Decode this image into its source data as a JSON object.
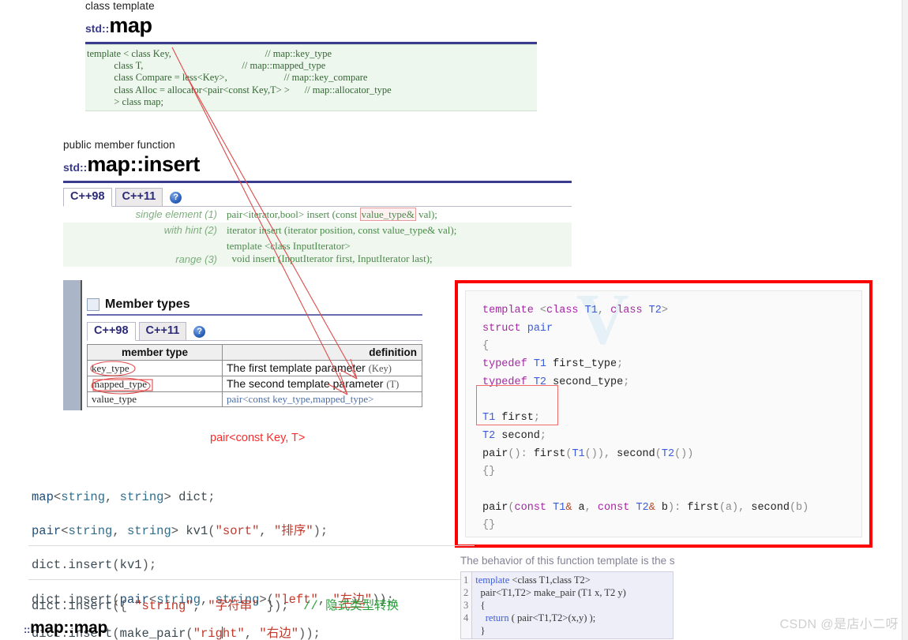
{
  "map_ref": {
    "kicker": "class template",
    "ns": "std::",
    "name": "map",
    "code_lines": [
      "template < class Key,                                      // map::key_type",
      "           class T,                                        // map::mapped_type",
      "           class Compare = less<Key>,                       // map::key_compare",
      "           class Alloc = allocator<pair<const Key,T> >      // map::allocator_type",
      "           > class map;"
    ]
  },
  "insert_ref": {
    "kicker": "public member function",
    "ns": "std::",
    "name": "map::insert",
    "tabs": [
      {
        "label": "C++98",
        "active": true
      },
      {
        "label": "C++11",
        "active": false
      }
    ],
    "help_icon": "?",
    "rows": [
      {
        "label": "single element (1)",
        "code_pre": "pair<iterator,bool> insert (const ",
        "code_box": "value_type&",
        "code_post": " val);"
      },
      {
        "label": "with hint (2)",
        "code_pre": "iterator insert (iterator position, const value_type& val);",
        "code_box": "",
        "code_post": ""
      },
      {
        "label": "range (3)",
        "code_pre": "template <class InputIterator>\n  void insert (InputIterator first, InputIterator last);",
        "code_box": "",
        "code_post": ""
      }
    ]
  },
  "member_types": {
    "heading": "Member types",
    "tabs": [
      {
        "label": "C++98",
        "active": true
      },
      {
        "label": "C++11",
        "active": false
      }
    ],
    "help_icon": "?",
    "columns": [
      "member type",
      "definition"
    ],
    "rows": [
      {
        "name": "key_type",
        "def_main": "The first template parameter ",
        "def_paren": "(Key)",
        "codey": false,
        "circled": true
      },
      {
        "name": "mapped_type",
        "def_main": "The second template parameter ",
        "def_paren": "(T)",
        "codey": false,
        "circled": true
      },
      {
        "name": "value_type",
        "def_main": "pair<const key_type,mapped_type>",
        "def_paren": "",
        "codey": true,
        "circled": false
      }
    ]
  },
  "pair_note": "pair<const Key, T>",
  "pair_panel": {
    "watermark": "V",
    "lines": [
      [
        {
          "t": "template ",
          "c": "kw"
        },
        {
          "t": "<",
          "c": "pun"
        },
        {
          "t": "class",
          "c": "kw"
        },
        {
          "t": " T1",
          "c": "ty"
        },
        {
          "t": ", ",
          "c": "pun"
        },
        {
          "t": "class",
          "c": "kw"
        },
        {
          "t": " T2",
          "c": "ty"
        },
        {
          "t": ">",
          "c": "pun"
        }
      ],
      [
        {
          "t": "struct ",
          "c": "kw"
        },
        {
          "t": "pair",
          "c": "ty"
        }
      ],
      [
        {
          "t": "{",
          "c": "pun"
        }
      ],
      [
        {
          "t": "typedef ",
          "c": "kw"
        },
        {
          "t": "T1",
          "c": "ty"
        },
        {
          "t": " first_type",
          "c": "idn"
        },
        {
          "t": ";",
          "c": "pun"
        }
      ],
      [
        {
          "t": "typedef ",
          "c": "kw"
        },
        {
          "t": "T2",
          "c": "ty"
        },
        {
          "t": " second_type",
          "c": "idn"
        },
        {
          "t": ";",
          "c": "pun"
        }
      ],
      [
        {
          "t": "",
          "c": "pun"
        }
      ],
      [
        {
          "t": "T1",
          "c": "ty"
        },
        {
          "t": " first",
          "c": "idn"
        },
        {
          "t": ";",
          "c": "pun"
        }
      ],
      [
        {
          "t": "T2",
          "c": "ty"
        },
        {
          "t": " second",
          "c": "idn"
        },
        {
          "t": ";",
          "c": "pun"
        }
      ],
      [
        {
          "t": "pair",
          "c": "idn"
        },
        {
          "t": "()",
          "c": "pun"
        },
        {
          "t": ": ",
          "c": "pun"
        },
        {
          "t": "first",
          "c": "idn"
        },
        {
          "t": "(",
          "c": "pun"
        },
        {
          "t": "T1",
          "c": "ty"
        },
        {
          "t": "())",
          "c": "pun"
        },
        {
          "t": ", ",
          "c": "pun"
        },
        {
          "t": "second",
          "c": "idn"
        },
        {
          "t": "(",
          "c": "pun"
        },
        {
          "t": "T2",
          "c": "ty"
        },
        {
          "t": "())",
          "c": "pun"
        }
      ],
      [
        {
          "t": "{}",
          "c": "pun"
        }
      ],
      [
        {
          "t": "",
          "c": "pun"
        }
      ],
      [
        {
          "t": "pair",
          "c": "idn"
        },
        {
          "t": "(",
          "c": "pun"
        },
        {
          "t": "const",
          "c": "kw"
        },
        {
          "t": " T1",
          "c": "ty"
        },
        {
          "t": "&",
          "c": "amp"
        },
        {
          "t": " a",
          "c": "idn"
        },
        {
          "t": ", ",
          "c": "pun"
        },
        {
          "t": "const",
          "c": "kw"
        },
        {
          "t": " T2",
          "c": "ty"
        },
        {
          "t": "&",
          "c": "amp"
        },
        {
          "t": " b",
          "c": "idn"
        },
        {
          "t": "): ",
          "c": "pun"
        },
        {
          "t": "first",
          "c": "idn"
        },
        {
          "t": "(a)",
          "c": "pun"
        },
        {
          "t": ", ",
          "c": "pun"
        },
        {
          "t": "second",
          "c": "idn"
        },
        {
          "t": "(b)",
          "c": "pun"
        }
      ],
      [
        {
          "t": "{}",
          "c": "pun"
        }
      ],
      [
        {
          "t": "};",
          "c": "pun"
        }
      ]
    ]
  },
  "editor": {
    "lines": [
      [
        {
          "t": "map",
          "c": "e-cls"
        },
        {
          "t": "<",
          "c": "e-pun"
        },
        {
          "t": "string",
          "c": "e-type"
        },
        {
          "t": ", ",
          "c": "e-pun"
        },
        {
          "t": "string",
          "c": "e-type"
        },
        {
          "t": "> ",
          "c": "e-pun"
        },
        {
          "t": "dict",
          "c": "e-id"
        },
        {
          "t": ";",
          "c": "e-pun"
        }
      ],
      [
        {
          "t": "pair",
          "c": "e-cls"
        },
        {
          "t": "<",
          "c": "e-pun"
        },
        {
          "t": "string",
          "c": "e-type"
        },
        {
          "t": ", ",
          "c": "e-pun"
        },
        {
          "t": "string",
          "c": "e-type"
        },
        {
          "t": "> ",
          "c": "e-pun"
        },
        {
          "t": "kv1",
          "c": "e-id"
        },
        {
          "t": "(",
          "c": "e-pun"
        },
        {
          "t": "\"sort\"",
          "c": "e-str"
        },
        {
          "t": ", ",
          "c": "e-pun"
        },
        {
          "t": "\"排序\"",
          "c": "e-str"
        },
        {
          "t": ");",
          "c": "e-pun"
        }
      ],
      [
        {
          "t": "dict",
          "c": "e-id"
        },
        {
          "t": ".",
          "c": "e-pun"
        },
        {
          "t": "insert",
          "c": "e-id"
        },
        {
          "t": "(",
          "c": "e-pun"
        },
        {
          "t": "kv1",
          "c": "e-id"
        },
        {
          "t": ");",
          "c": "e-pun"
        }
      ],
      [
        {
          "t": "dict",
          "c": "e-id"
        },
        {
          "t": ".",
          "c": "e-pun"
        },
        {
          "t": "insert",
          "c": "e-id"
        },
        {
          "t": "(",
          "c": "e-pun"
        },
        {
          "t": "pair",
          "c": "e-cls"
        },
        {
          "t": "<",
          "c": "e-pun"
        },
        {
          "t": "string",
          "c": "e-type"
        },
        {
          "t": ", ",
          "c": "e-pun"
        },
        {
          "t": "string",
          "c": "e-type"
        },
        {
          "t": ">(",
          "c": "e-pun"
        },
        {
          "t": "\"left\"",
          "c": "e-str"
        },
        {
          "t": ", ",
          "c": "e-pun"
        },
        {
          "t": "\"左边\"",
          "c": "e-cn"
        },
        {
          "t": "));",
          "c": "e-pun"
        }
      ],
      [
        {
          "t": "dict",
          "c": "e-id"
        },
        {
          "t": ".",
          "c": "e-pun"
        },
        {
          "t": "insert",
          "c": "e-id"
        },
        {
          "t": "(",
          "c": "e-pun"
        },
        {
          "t": "make_pair",
          "c": "e-id"
        },
        {
          "t": "(",
          "c": "e-pun"
        },
        {
          "t": "\"right\"",
          "c": "e-str"
        },
        {
          "t": ", ",
          "c": "e-pun"
        },
        {
          "t": "\"右边\"",
          "c": "e-cn"
        },
        {
          "t": "));",
          "c": "e-pun"
        }
      ]
    ],
    "last_line": [
      {
        "t": "dict",
        "c": "e-id"
      },
      {
        "t": ".",
        "c": "e-pun"
      },
      {
        "t": "insert",
        "c": "e-id"
      },
      {
        "t": "({ ",
        "c": "e-pun"
      },
      {
        "t": "\"string\"",
        "c": "e-str"
      },
      {
        "t": ", ",
        "c": "e-pun"
      },
      {
        "t": "\"字符串\"",
        "c": "e-str"
      },
      {
        "t": " });",
        "c": "e-pun"
      },
      {
        "t": "  ",
        "c": "e-pun"
      },
      {
        "t": "// 隐式类型转换",
        "c": "e-cmt"
      }
    ]
  },
  "map_map_title": {
    "ns": "::",
    "name": "map::map"
  },
  "make_pair_snippet": {
    "ghost_text": "The behavior of this function template is the s",
    "line_numbers": "1\n2\n3\n4",
    "lines": [
      [
        {
          "t": "template ",
          "c": "k"
        },
        {
          "t": "<class T1,class T2>",
          "c": ""
        }
      ],
      [
        {
          "t": "  pair<T1,T2> make_pair (T1 x, T2 y)",
          "c": ""
        }
      ],
      [
        {
          "t": "  {",
          "c": ""
        }
      ],
      [
        {
          "t": "    ",
          "c": ""
        },
        {
          "t": "return",
          "c": "k"
        },
        {
          "t": " ( pair<T1,T2>(x,y) );",
          "c": ""
        }
      ],
      [
        {
          "t": "  }",
          "c": ""
        }
      ]
    ]
  },
  "watermark": "CSDN @是店小二呀"
}
